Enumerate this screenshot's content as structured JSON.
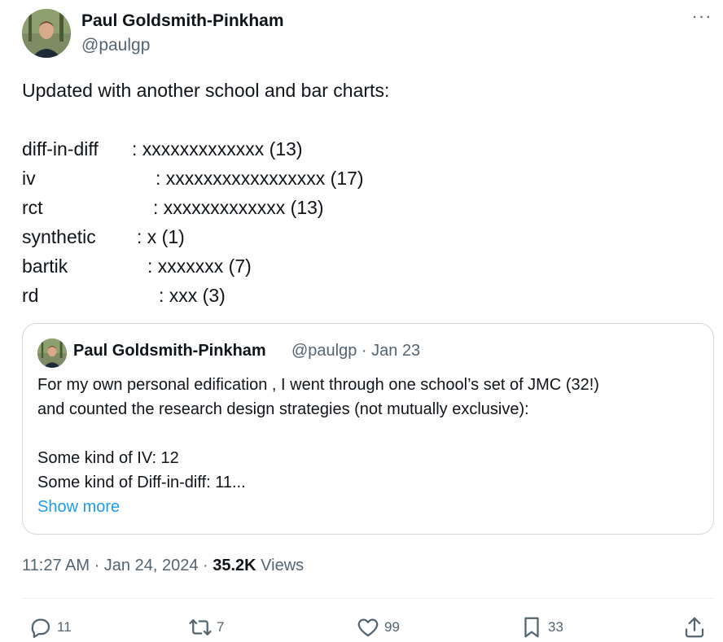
{
  "author": {
    "name": "Paul Goldsmith-Pinkham",
    "handle": "@paulgp"
  },
  "more_icon": "more-horizontal-icon",
  "tweet": {
    "intro": "Updated with another school and bar charts:",
    "rows": [
      {
        "label": "diff-in-diff",
        "bar": ": xxxxxxxxxxxxx (13)"
      },
      {
        "label": "iv",
        "bar": ": xxxxxxxxxxxxxxxxx (17)"
      },
      {
        "label": "rct",
        "bar": ": xxxxxxxxxxxxx (13)"
      },
      {
        "label": "synthetic",
        "bar": ": x (1)"
      },
      {
        "label": "bartik",
        "bar": ": xxxxxxx (7)"
      },
      {
        "label": "rd",
        "bar": ": xxx (3)"
      }
    ]
  },
  "quote": {
    "name": "Paul Goldsmith-Pinkham",
    "handle_date": "@paulgp · Jan 23",
    "line1": "For my own personal edification , I went through one school’s set of JMC (32!)",
    "line2": "and counted the research design strategies (not mutually exclusive):",
    "line3": "Some kind of IV: 12",
    "line4": "Some kind of Diff-in-diff: 11...",
    "show_more": "Show more"
  },
  "meta": {
    "time_date": "11:27 AM · Jan 24, 2024 · ",
    "views_count": "35.2K",
    "views_label": " Views"
  },
  "actions": {
    "reply": "11",
    "retweet": "7",
    "like": "99",
    "bookmark": "33"
  },
  "colors": {
    "text": "#0f1419",
    "secondary": "#536471",
    "link": "#1d9bf0",
    "border": "#cfd9de"
  }
}
